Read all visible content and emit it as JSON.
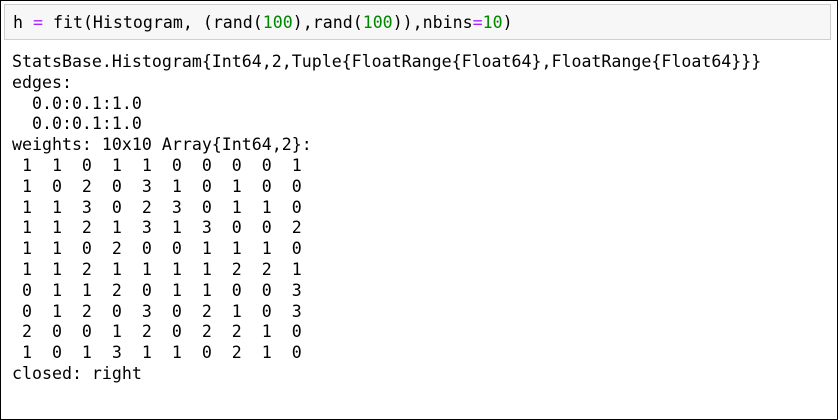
{
  "input_cell": {
    "tokens": [
      {
        "text": "h ",
        "kind": "plain"
      },
      {
        "text": "=",
        "kind": "op"
      },
      {
        "text": " fit(Histogram, (rand(",
        "kind": "plain"
      },
      {
        "text": "100",
        "kind": "num"
      },
      {
        "text": "),rand(",
        "kind": "plain"
      },
      {
        "text": "100",
        "kind": "num"
      },
      {
        "text": ")),nbins",
        "kind": "plain"
      },
      {
        "text": "=",
        "kind": "op"
      },
      {
        "text": "10",
        "kind": "num"
      },
      {
        "text": ")",
        "kind": "plain"
      }
    ]
  },
  "output": {
    "type_line": "StatsBase.Histogram{Int64,2,Tuple{FloatRange{Float64},FloatRange{Float64}}}",
    "edges_label": "edges:",
    "edges": [
      "  0.0:0.1:1.0",
      "  0.0:0.1:1.0"
    ],
    "weights_label": "weights: 10x10 Array{Int64,2}:",
    "weights": [
      [
        1,
        1,
        0,
        1,
        1,
        0,
        0,
        0,
        0,
        1
      ],
      [
        1,
        0,
        2,
        0,
        3,
        1,
        0,
        1,
        0,
        0
      ],
      [
        1,
        1,
        3,
        0,
        2,
        3,
        0,
        1,
        1,
        0
      ],
      [
        1,
        1,
        2,
        1,
        3,
        1,
        3,
        0,
        0,
        2
      ],
      [
        1,
        1,
        0,
        2,
        0,
        0,
        1,
        1,
        1,
        0
      ],
      [
        1,
        1,
        2,
        1,
        1,
        1,
        1,
        2,
        2,
        1
      ],
      [
        0,
        1,
        1,
        2,
        0,
        1,
        1,
        0,
        0,
        3
      ],
      [
        0,
        1,
        2,
        0,
        3,
        0,
        2,
        1,
        0,
        3
      ],
      [
        2,
        0,
        0,
        1,
        2,
        0,
        2,
        2,
        1,
        0
      ],
      [
        1,
        0,
        1,
        3,
        1,
        1,
        0,
        2,
        1,
        0
      ]
    ],
    "closed_line": "closed: right"
  },
  "colors": {
    "number": "#008800",
    "operator": "#aa22ff",
    "cell_background": "#f7f7f7",
    "cell_border": "#cfcfcf"
  }
}
